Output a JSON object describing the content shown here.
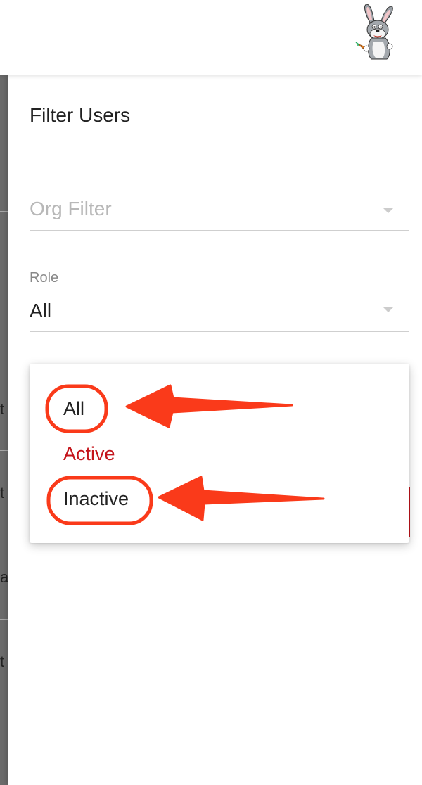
{
  "drawer": {
    "title": "Filter Users"
  },
  "org_filter": {
    "placeholder": "Org Filter"
  },
  "role_select": {
    "label": "Role",
    "value": "All"
  },
  "status_menu": {
    "options": [
      {
        "label": "All"
      },
      {
        "label": "Active",
        "selected": true
      },
      {
        "label": "Inactive"
      }
    ]
  },
  "background_rows": [
    "t",
    "t",
    "al",
    "t"
  ],
  "colors": {
    "accent_red": "#c4141b",
    "annotation_red": "#fa3a1a"
  },
  "icons": {
    "avatar": "cartoon-rabbit-avatar"
  }
}
